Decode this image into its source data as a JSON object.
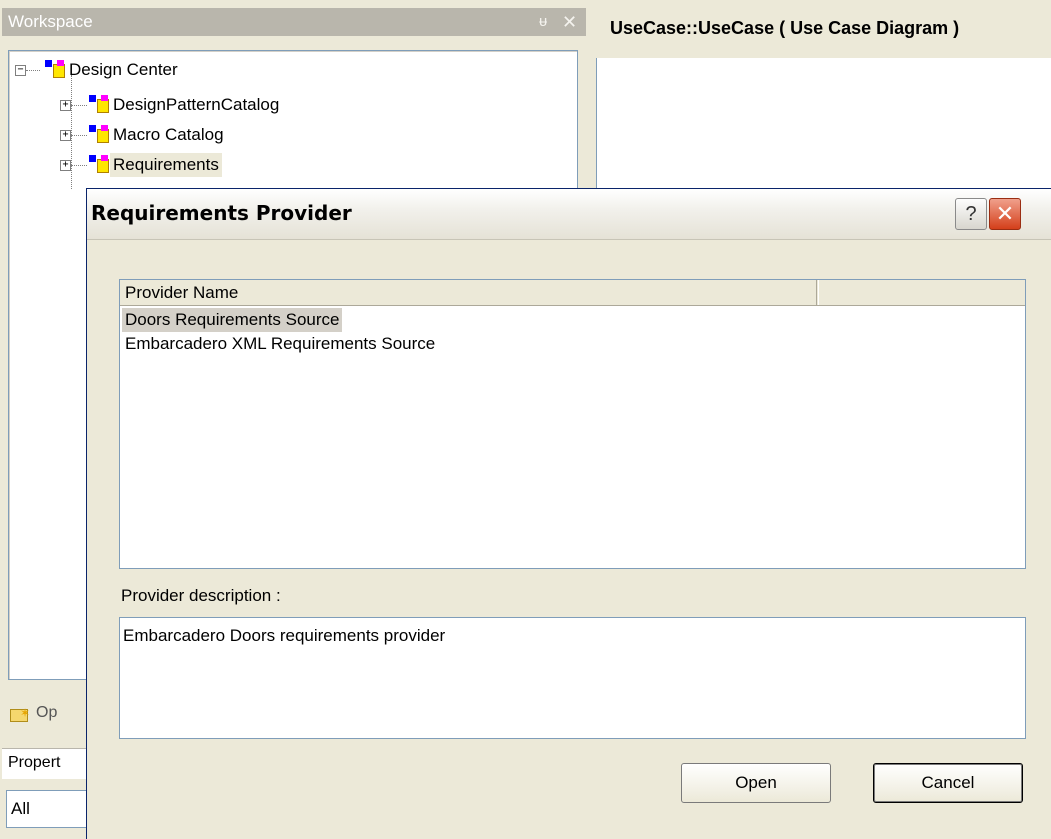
{
  "workspace": {
    "title": "Workspace",
    "pin_glyph": "ᵾ",
    "close_glyph": "✕",
    "tree": {
      "root": {
        "label": "Design Center",
        "expander": "−",
        "icon": "package-icon"
      },
      "children": [
        {
          "label": "DesignPatternCatalog",
          "expander": "+",
          "icon": "package-icon"
        },
        {
          "label": "Macro Catalog",
          "expander": "+",
          "icon": "package-icon"
        },
        {
          "label": "Requirements",
          "expander": "+",
          "icon": "package-icon",
          "selected": true
        }
      ]
    },
    "open_tab_label": "Op",
    "properties_label": "Propert",
    "properties_filter": "All"
  },
  "diagram": {
    "tab_title": "UseCase::UseCase ( Use Case Diagram )"
  },
  "dialog": {
    "title": "Requirements Provider",
    "help_glyph": "?",
    "close_glyph": "✕",
    "columns": [
      "Provider Name",
      ""
    ],
    "providers": [
      {
        "name": "Doors Requirements Source",
        "selected": true
      },
      {
        "name": "Embarcadero XML Requirements Source",
        "selected": false
      }
    ],
    "description_label": "Provider description :",
    "description_text": "Embarcadero Doors requirements provider",
    "open_label": "Open",
    "cancel_label": "Cancel"
  },
  "colors": {
    "dialog_border": "#0a246a",
    "selection": "#d4d0c8",
    "close_button": "#d43f1a",
    "panel_header": "#b9b6ac"
  }
}
